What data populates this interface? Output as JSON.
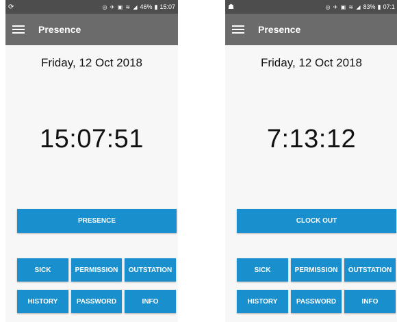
{
  "screens": [
    {
      "status": {
        "left_icon": "sync-icon",
        "right_text": "46%",
        "time": "15:07",
        "icons": "◎ ✈ ▣ ≋ ◢"
      },
      "appbar": {
        "title": "Presence"
      },
      "date": "Friday, 12 Oct 2018",
      "clock": "15:07:51",
      "main_button": "PRESENCE",
      "buttons": [
        "SICK",
        "PERMISSION",
        "OUTSTATION",
        "HISTORY",
        "PASSWORD",
        "INFO"
      ]
    },
    {
      "status": {
        "left_icon": "android-icon",
        "right_text": "83%",
        "time": "07:1",
        "icons": "◎ ✈ ▣ ≋ ◢"
      },
      "appbar": {
        "title": "Presence"
      },
      "date": "Friday, 12 Oct 2018",
      "clock": "7:13:12",
      "main_button": "CLOCK OUT",
      "buttons": [
        "SICK",
        "PERMISSION",
        "OUTSTATION",
        "HISTORY",
        "PASSWORD",
        "INFO"
      ]
    }
  ],
  "colors": {
    "accent": "#1a8fcd",
    "appbar": "#6b6b6b",
    "statusbar": "#4d4d4d",
    "background": "#f7f7f7"
  }
}
